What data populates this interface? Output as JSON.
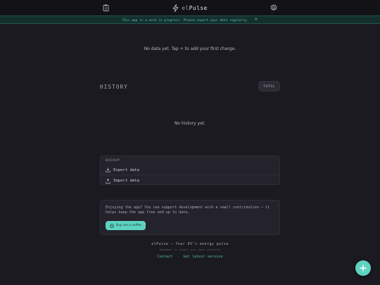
{
  "header": {
    "logo_prefix": "el",
    "logo_suffix": "Pulse",
    "left_icon": "clipboard-icon",
    "right_icon": "gear-icon",
    "brand_icon": "lightning-bolt-icon"
  },
  "banner": {
    "text": "This app is a work in progress. Please export your data regularly.",
    "close_label": "×"
  },
  "charges": {
    "empty_text": "No data yet. Tap + to add your first charge."
  },
  "history": {
    "title": "HISTORY",
    "total_label": "TOTAL",
    "empty_text": "No history yet."
  },
  "backup": {
    "heading": "BACKUP",
    "export_label": "Export data",
    "import_label": "Import data"
  },
  "support": {
    "text": "Enjoying the app? You can support development with a small contribution — it helps keep the app free and up to date.",
    "coffee_label": "Buy me a coffee"
  },
  "footer": {
    "brand": "elPulse — Your EV's energy pulse",
    "reminder": "Remember to export your data regularly",
    "contact_label": "Contact",
    "separator": "·",
    "latest_label": "Get latest version"
  },
  "colors": {
    "accent": "#5ed3c1",
    "background": "#1b1a21",
    "card": "#24232b"
  }
}
